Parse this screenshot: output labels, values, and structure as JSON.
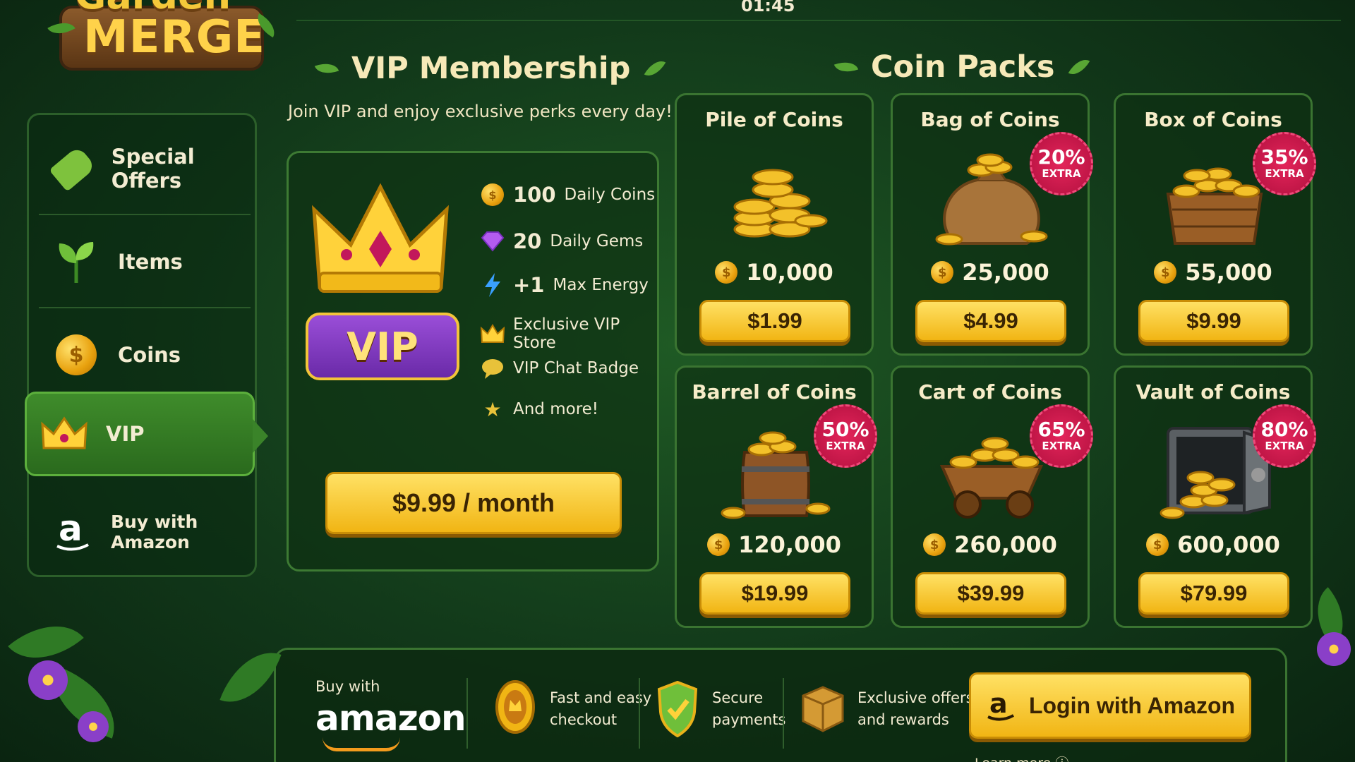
{
  "status": {
    "clock": "01:45"
  },
  "logo": {
    "line1": "Garden",
    "line2": "MERGE"
  },
  "sidebar": {
    "items": [
      {
        "label": "Special Offers",
        "icon": "price-tag-icon"
      },
      {
        "label": "Items",
        "icon": "sprout-icon"
      },
      {
        "label": "Coins",
        "icon": "coin-icon"
      },
      {
        "label": "VIP",
        "icon": "crown-icon",
        "active": true
      },
      {
        "label": "Buy with Amazon",
        "icon": "amazon-icon"
      }
    ],
    "active_color": "#3f8c2b"
  },
  "vip": {
    "title": "VIP Membership",
    "subtitle": "Join VIP and enjoy exclusive perks every day!",
    "badge_text": "VIP",
    "perks": [
      {
        "num": "100",
        "text": "Daily Coins",
        "icon": "coin-icon"
      },
      {
        "num": "20",
        "text": "Daily Gems",
        "icon": "gem-icon"
      },
      {
        "num": "+1",
        "text": "Max Energy",
        "icon": "lightning-icon"
      },
      {
        "num": "",
        "text": "Exclusive VIP Store",
        "icon": "crown-icon"
      },
      {
        "num": "",
        "text": "VIP Chat Badge",
        "icon": "chat-bubble-icon"
      },
      {
        "num": "",
        "text": "And more!",
        "icon": "star-icon"
      }
    ],
    "price_label": "$9.99 / month"
  },
  "coin_packs": {
    "title": "Coin Packs",
    "packs": [
      {
        "name": "Pile of Coins",
        "amount": "10,000",
        "price": "$1.99",
        "extra_pct": "",
        "extra_label": ""
      },
      {
        "name": "Bag of Coins",
        "amount": "25,000",
        "price": "$4.99",
        "extra_pct": "20%",
        "extra_label": "EXTRA"
      },
      {
        "name": "Box of Coins",
        "amount": "55,000",
        "price": "$9.99",
        "extra_pct": "35%",
        "extra_label": "EXTRA"
      },
      {
        "name": "Barrel of Coins",
        "amount": "120,000",
        "price": "$19.99",
        "extra_pct": "50%",
        "extra_label": "EXTRA"
      },
      {
        "name": "Cart of Coins",
        "amount": "260,000",
        "price": "$39.99",
        "extra_pct": "65%",
        "extra_label": "EXTRA"
      },
      {
        "name": "Vault of Coins",
        "amount": "600,000",
        "price": "$79.99",
        "extra_pct": "80%",
        "extra_label": "EXTRA"
      }
    ]
  },
  "amazon_bar": {
    "buy_with": "Buy with",
    "brand": "amazon",
    "features": [
      {
        "text1": "Fast and easy",
        "text2": "checkout",
        "icon": "medal-icon"
      },
      {
        "text1": "Secure",
        "text2": "payments",
        "icon": "shield-check-icon"
      },
      {
        "text1": "Exclusive offers",
        "text2": "and rewards",
        "icon": "package-icon"
      }
    ],
    "login_label": "Login with Amazon",
    "learn_more": "Learn more"
  },
  "colors": {
    "gold": "#f1b514",
    "badge": "#c4154a",
    "panel_border": "#3a7431"
  }
}
